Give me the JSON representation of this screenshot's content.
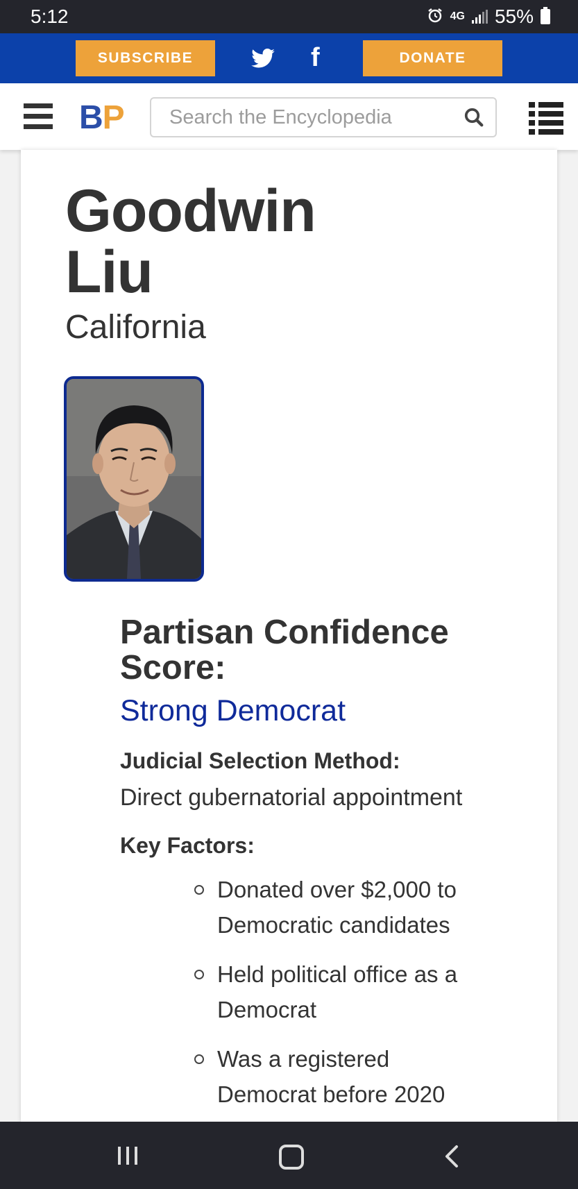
{
  "status_bar": {
    "time": "5:12",
    "network": "4G",
    "battery": "55%",
    "icons": [
      "alarm-icon",
      "network-4g-icon",
      "signal-icon",
      "battery-icon"
    ]
  },
  "social_bar": {
    "subscribe_label": "SUBSCRIBE",
    "donate_label": "DONATE",
    "icons": [
      "twitter-icon",
      "facebook-icon"
    ],
    "background_color": "#0c41aa",
    "button_color": "#eda23a"
  },
  "header": {
    "logo_b": "B",
    "logo_p": "P",
    "search_placeholder": "Search the Encyclopedia",
    "icons": [
      "hamburger-menu-icon",
      "search-icon",
      "list-icon"
    ]
  },
  "profile": {
    "name_line1": "Goodwin",
    "name_line2": "Liu",
    "state": "California",
    "photo_icon": "portrait-photo",
    "photo_border_color": "#0d2a90"
  },
  "score": {
    "title_line1": "Partisan Confidence",
    "title_line2": "Score:",
    "value": "Strong Democrat",
    "value_color": "#0f2a9a"
  },
  "selection": {
    "label": "Judicial Selection Method:",
    "value": "Direct gubernatorial appointment"
  },
  "key_factors": {
    "label": "Key Factors:",
    "items": [
      {
        "line1": "Donated over $2,000 to",
        "line2": "Democratic candidates"
      },
      {
        "line1": "Held political office as a",
        "line2": "Democrat"
      },
      {
        "line1": "Was a registered",
        "line2": "Democrat before 2020"
      }
    ]
  },
  "nav_bar": {
    "icons": [
      "recent-apps-icon",
      "home-icon",
      "back-icon"
    ]
  }
}
